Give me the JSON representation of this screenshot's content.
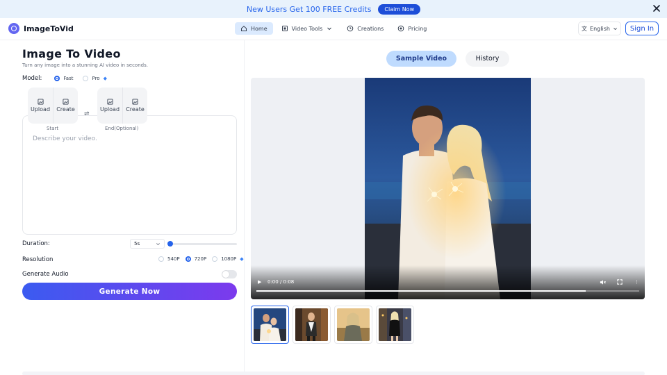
{
  "promo": {
    "text": "New Users Get 100 FREE Credits",
    "button": "Claim Now"
  },
  "nav": {
    "brand": "ImageToVid",
    "links": [
      {
        "label": "Home",
        "icon": "home-icon",
        "active": true
      },
      {
        "label": "Video Tools",
        "icon": "video-tools-icon",
        "active": false,
        "has_dropdown": true
      },
      {
        "label": "Creations",
        "icon": "clock-icon",
        "active": false
      },
      {
        "label": "Pricing",
        "icon": "pricing-icon",
        "active": false
      }
    ],
    "language": "English",
    "signin": "Sign In"
  },
  "form": {
    "title": "Image To Video",
    "subtitle": "Turn any image into a stunning AI video in seconds.",
    "model_label": "Model:",
    "model_options": [
      {
        "label": "Fast",
        "selected": true
      },
      {
        "label": "Pro",
        "selected": false,
        "premium": true
      }
    ],
    "start_frame": {
      "upload": "Upload",
      "create": "Create",
      "caption": "Start"
    },
    "end_frame": {
      "upload": "Upload",
      "create": "Create",
      "caption": "End(Optional)"
    },
    "prompt_placeholder": "Describe your video.",
    "duration_label": "Duration:",
    "duration_value": "5s",
    "duration_slider_fraction": 0,
    "resolution_label": "Resolution",
    "resolution_options": [
      {
        "label": "540P",
        "selected": false
      },
      {
        "label": "720P",
        "selected": true
      },
      {
        "label": "1080P",
        "selected": false,
        "premium": true
      }
    ],
    "audio_label": "Generate Audio",
    "audio_enabled": false,
    "generate_button": "Generate Now"
  },
  "preview": {
    "tabs": [
      {
        "label": "Sample Video",
        "active": true
      },
      {
        "label": "History",
        "active": false
      }
    ],
    "player": {
      "time": "0:00 / 0:08",
      "progress_fraction": 0.86
    },
    "thumbnails": [
      {
        "name": "couple-sparklers",
        "selected": true
      },
      {
        "name": "woman-city-street",
        "selected": false
      },
      {
        "name": "woman-sunset-field",
        "selected": false
      },
      {
        "name": "woman-black-dress-city",
        "selected": false
      }
    ]
  },
  "colors": {
    "accent": "#2563eb",
    "button_start": "#3b5bf0",
    "button_end": "#7c3aed"
  }
}
